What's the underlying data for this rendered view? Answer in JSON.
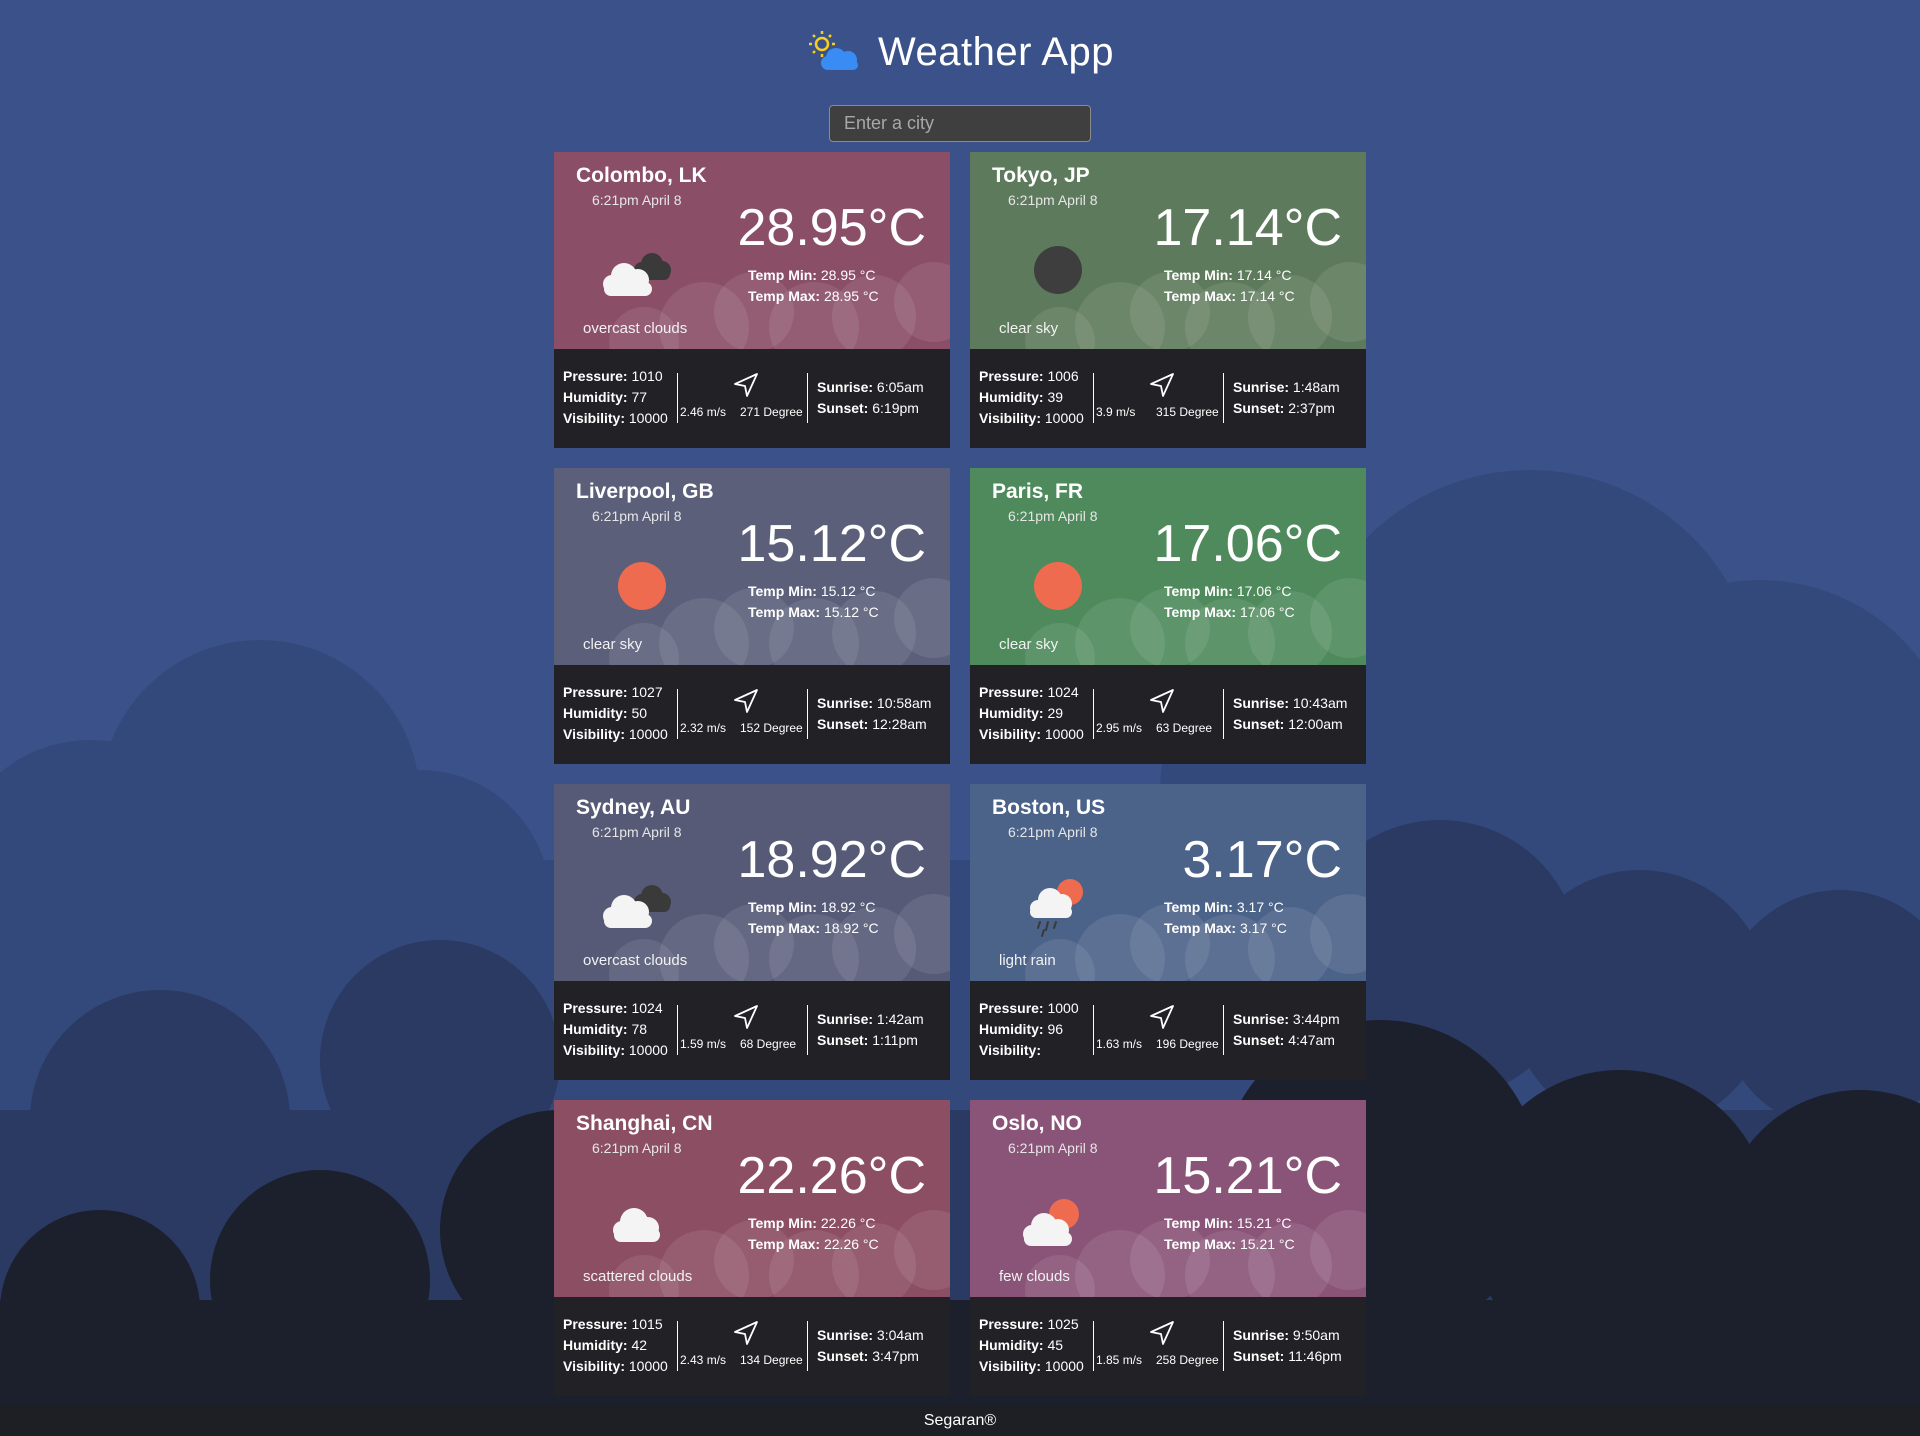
{
  "app": {
    "title": "Weather App",
    "logo_icon": "sun-cloud-icon",
    "search_placeholder": "Enter a city",
    "footer": "Segaran®"
  },
  "labels": {
    "temp_min": "Temp Min:",
    "temp_max": "Temp Max:",
    "pressure": "Pressure:",
    "humidity": "Humidity:",
    "visibility": "Visibility:",
    "sunrise": "Sunrise:",
    "sunset": "Sunset:"
  },
  "colors": {
    "background": "#3a5289",
    "clouds_mid": "#2e3a5f",
    "clouds_dark": "#1c1f2c",
    "card_bottom": "#222226"
  },
  "cards": [
    {
      "city": "Colombo, LK",
      "time": "6:21pm April 8",
      "temp": "28.95°C",
      "temp_min": "28.95 °C",
      "temp_max": "28.95 °C",
      "description": "overcast clouds",
      "icon": "overcast-clouds-icon",
      "color": "#8a4e67",
      "pressure": "1010",
      "humidity": "77",
      "visibility": "10000",
      "wind_speed": "2.46 m/s",
      "wind_degree": "271 Degree",
      "sunrise": "6:05am",
      "sunset": "6:19pm"
    },
    {
      "city": "Tokyo, JP",
      "time": "6:21pm April 8",
      "temp": "17.14°C",
      "temp_min": "17.14 °C",
      "temp_max": "17.14 °C",
      "description": "clear sky",
      "icon": "clear-night-icon",
      "color": "#5e7a5c",
      "pressure": "1006",
      "humidity": "39",
      "visibility": "10000",
      "wind_speed": "3.9 m/s",
      "wind_degree": "315 Degree",
      "sunrise": "1:48am",
      "sunset": "2:37pm"
    },
    {
      "city": "Liverpool, GB",
      "time": "6:21pm April 8",
      "temp": "15.12°C",
      "temp_min": "15.12 °C",
      "temp_max": "15.12 °C",
      "description": "clear sky",
      "icon": "clear-sun-icon",
      "color": "#5b5f79",
      "pressure": "1027",
      "humidity": "50",
      "visibility": "10000",
      "wind_speed": "2.32 m/s",
      "wind_degree": "152 Degree",
      "sunrise": "10:58am",
      "sunset": "12:28am"
    },
    {
      "city": "Paris, FR",
      "time": "6:21pm April 8",
      "temp": "17.06°C",
      "temp_min": "17.06 °C",
      "temp_max": "17.06 °C",
      "description": "clear sky",
      "icon": "clear-sun-icon",
      "color": "#4e8a5c",
      "pressure": "1024",
      "humidity": "29",
      "visibility": "10000",
      "wind_speed": "2.95 m/s",
      "wind_degree": "63 Degree",
      "sunrise": "10:43am",
      "sunset": "12:00am"
    },
    {
      "city": "Sydney, AU",
      "time": "6:21pm April 8",
      "temp": "18.92°C",
      "temp_min": "18.92 °C",
      "temp_max": "18.92 °C",
      "description": "overcast clouds",
      "icon": "overcast-clouds-icon",
      "color": "#565a76",
      "pressure": "1024",
      "humidity": "78",
      "visibility": "10000",
      "wind_speed": "1.59 m/s",
      "wind_degree": "68 Degree",
      "sunrise": "1:42am",
      "sunset": "1:11pm"
    },
    {
      "city": "Boston, US",
      "time": "6:21pm April 8",
      "temp": "3.17°C",
      "temp_min": "3.17 °C",
      "temp_max": "3.17 °C",
      "description": "light rain",
      "icon": "light-rain-icon",
      "color": "#4b6289",
      "pressure": "1000",
      "humidity": "96",
      "visibility": "",
      "wind_speed": "1.63 m/s",
      "wind_degree": "196 Degree",
      "sunrise": "3:44pm",
      "sunset": "4:47am"
    },
    {
      "city": "Shanghai, CN",
      "time": "6:21pm April 8",
      "temp": "22.26°C",
      "temp_min": "22.26 °C",
      "temp_max": "22.26 °C",
      "description": "scattered clouds",
      "icon": "scattered-clouds-icon",
      "color": "#8c4e62",
      "pressure": "1015",
      "humidity": "42",
      "visibility": "10000",
      "wind_speed": "2.43 m/s",
      "wind_degree": "134 Degree",
      "sunrise": "3:04am",
      "sunset": "3:47pm"
    },
    {
      "city": "Oslo, NO",
      "time": "6:21pm April 8",
      "temp": "15.21°C",
      "temp_min": "15.21 °C",
      "temp_max": "15.21 °C",
      "description": "few clouds",
      "icon": "few-clouds-icon",
      "color": "#8a5478",
      "pressure": "1025",
      "humidity": "45",
      "visibility": "10000",
      "wind_speed": "1.85 m/s",
      "wind_degree": "258 Degree",
      "sunrise": "9:50am",
      "sunset": "11:46pm"
    }
  ]
}
